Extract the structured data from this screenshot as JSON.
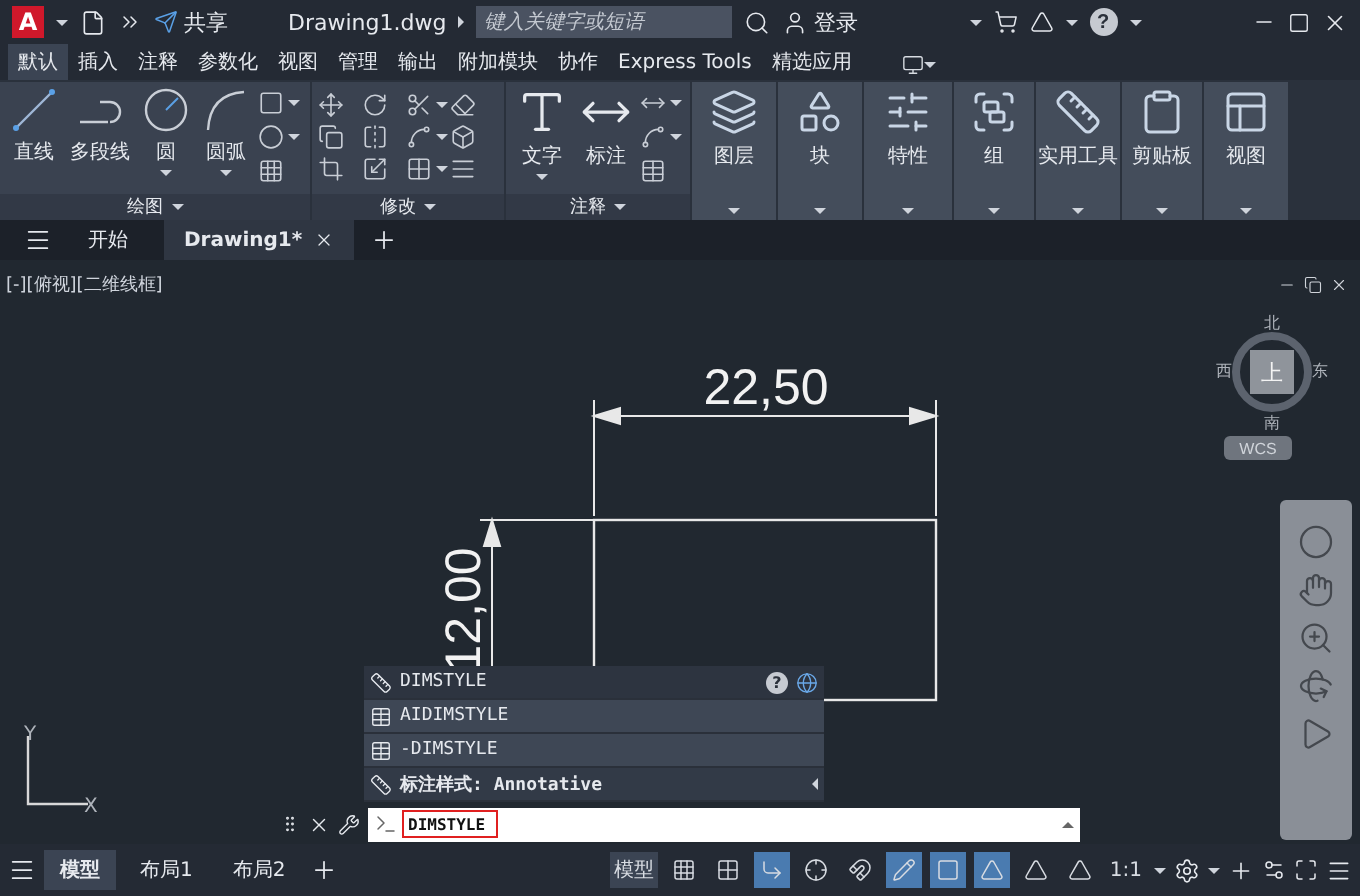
{
  "title_bar": {
    "logo": "A",
    "share": "共享",
    "file_name": "Drawing1.dwg",
    "search": {
      "placeholder": "键入关键字或短语"
    },
    "sign_in": "登录",
    "help": "?"
  },
  "ribbon_tabs": [
    {
      "label": "默认",
      "selected": true
    },
    {
      "label": "插入",
      "selected": false
    },
    {
      "label": "注释",
      "selected": false
    },
    {
      "label": "参数化",
      "selected": false
    },
    {
      "label": "视图",
      "selected": false
    },
    {
      "label": "管理",
      "selected": false
    },
    {
      "label": "输出",
      "selected": false
    },
    {
      "label": "附加模块",
      "selected": false
    },
    {
      "label": "协作",
      "selected": false
    },
    {
      "label": "Express Tools",
      "selected": false
    },
    {
      "label": "精选应用",
      "selected": false
    }
  ],
  "ribbon_panels": [
    {
      "kind": "tools",
      "title": "绘图",
      "tools": [
        {
          "label": "直线",
          "dropdown": false
        },
        {
          "label": "多段线",
          "dropdown": false
        },
        {
          "label": "圆",
          "dropdown": true
        },
        {
          "label": "圆弧",
          "dropdown": true
        }
      ]
    },
    {
      "kind": "grid",
      "title": "修改"
    },
    {
      "kind": "tools",
      "title": "注释",
      "tools": [
        {
          "label": "文字",
          "dropdown": true
        },
        {
          "label": "标注",
          "dropdown": false
        }
      ]
    },
    {
      "kind": "big",
      "label": "图层"
    },
    {
      "kind": "big",
      "label": "块"
    },
    {
      "kind": "big",
      "label": "特性"
    },
    {
      "kind": "big",
      "label": "组"
    },
    {
      "kind": "big",
      "label": "实用工具"
    },
    {
      "kind": "big",
      "label": "剪贴板"
    },
    {
      "kind": "big",
      "label": "视图"
    }
  ],
  "doc_tabs": [
    {
      "label": "开始",
      "selected": false
    },
    {
      "label": "Drawing1*",
      "selected": true
    }
  ],
  "viewport_label": "[-][俯视][二维线框]",
  "view_cube": {
    "top": "上",
    "north": "北",
    "south": "南",
    "east": "东",
    "west": "西",
    "coordinate_system": "WCS"
  },
  "drawing": {
    "horizontal_dimension": "22,50",
    "vertical_dimension": "12,00"
  },
  "ucs": {
    "x": "X",
    "y": "Y"
  },
  "command_suggestions": [
    {
      "kind": "primary",
      "label": "DIMSTYLE"
    },
    {
      "kind": "command",
      "label": "AIDIMSTYLE"
    },
    {
      "kind": "command",
      "label": "-DIMSTYLE"
    },
    {
      "kind": "submenu",
      "label": "标注样式: Annotative"
    }
  ],
  "command_line": {
    "value": "DIMSTYLE"
  },
  "layout_tabs": [
    {
      "label": "模型",
      "selected": true
    },
    {
      "label": "布局1",
      "selected": false
    },
    {
      "label": "布局2",
      "selected": false
    }
  ],
  "status_bar": {
    "model": "模型",
    "scale": "1:1",
    "tools": [
      {
        "kind": "grid",
        "on": false
      },
      {
        "kind": "snap",
        "on": false
      },
      {
        "kind": "ortho",
        "on": true
      },
      {
        "kind": "polar",
        "on": false
      },
      {
        "kind": "isodraft",
        "on": false
      },
      {
        "kind": "dynamic",
        "on": true
      },
      {
        "kind": "osnap",
        "on": true
      },
      {
        "kind": "annotation",
        "on": true
      },
      {
        "kind": "autoscale",
        "on": false
      },
      {
        "kind": "annoscale",
        "on": false
      }
    ]
  }
}
